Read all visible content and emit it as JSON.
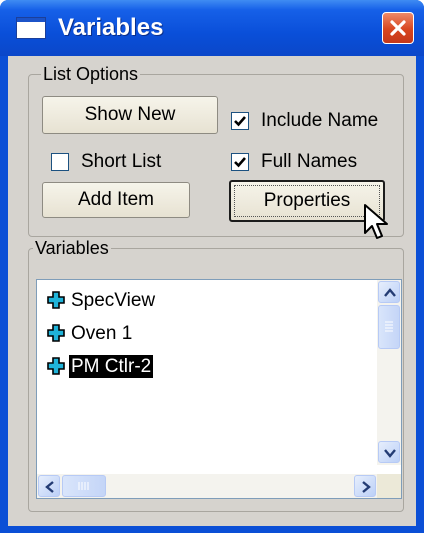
{
  "window": {
    "title": "Variables",
    "icons": {
      "app": "window-icon",
      "close": "close-x-icon"
    },
    "colors": {
      "titlebar": "#0b4fd6",
      "close": "#d8451f",
      "face": "#d6d3ce"
    }
  },
  "list_options": {
    "legend": "List Options",
    "show_new_label": "Show New",
    "add_item_label": "Add Item",
    "properties_label": "Properties",
    "include_name": {
      "label": "Include Name",
      "checked": true
    },
    "short_list": {
      "label": "Short List",
      "checked": false
    },
    "full_names": {
      "label": "Full Names",
      "checked": true
    }
  },
  "variables": {
    "legend": "Variables",
    "items": [
      {
        "label": "SpecView",
        "icon": "plus-expand-icon",
        "selected": false
      },
      {
        "label": "Oven 1",
        "icon": "plus-expand-icon",
        "selected": false
      },
      {
        "label": "PM Ctlr-2",
        "icon": "plus-expand-icon",
        "selected": true
      }
    ]
  }
}
